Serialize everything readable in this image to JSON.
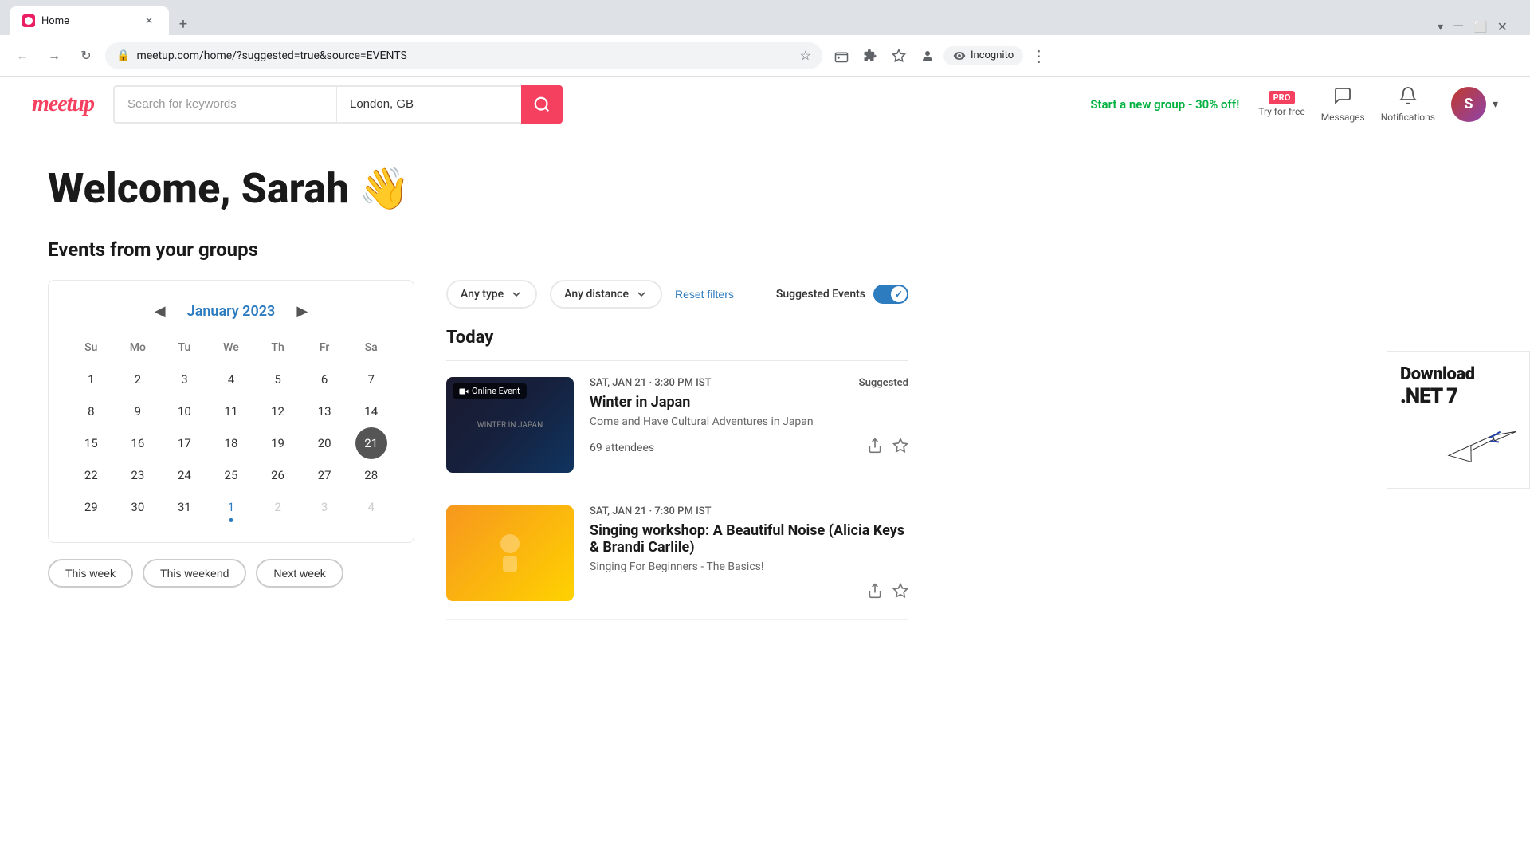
{
  "browser": {
    "tab": {
      "title": "Home",
      "favicon_label": "meetup-favicon"
    },
    "address": "meetup.com/home/?suggested=true&source=EVENTS",
    "incognito_label": "Incognito"
  },
  "header": {
    "logo": "meetup",
    "search_placeholder": "Search for keywords",
    "location_value": "London, GB",
    "search_button_label": "Search",
    "promo_text": "Start a new group - 30% off!",
    "pro_label": "PRO",
    "try_for_free_label": "Try for free",
    "messages_label": "Messages",
    "notifications_label": "Notifications",
    "dropdown_arrow": "▾"
  },
  "main": {
    "welcome_text": "Welcome, Sarah",
    "wave_emoji": "👋",
    "section_title": "Events from your groups"
  },
  "calendar": {
    "month_year": "January 2023",
    "prev_label": "◀",
    "next_label": "▶",
    "day_headers": [
      "Su",
      "Mo",
      "Tu",
      "We",
      "Th",
      "Fr",
      "Sa"
    ],
    "weeks": [
      [
        {
          "day": 1,
          "other": false
        },
        {
          "day": 2,
          "other": false
        },
        {
          "day": 3,
          "other": false
        },
        {
          "day": 4,
          "other": false
        },
        {
          "day": 5,
          "other": false
        },
        {
          "day": 6,
          "other": false
        },
        {
          "day": 7,
          "other": false
        }
      ],
      [
        {
          "day": 8,
          "other": false
        },
        {
          "day": 9,
          "other": false
        },
        {
          "day": 10,
          "other": false
        },
        {
          "day": 11,
          "other": false
        },
        {
          "day": 12,
          "other": false
        },
        {
          "day": 13,
          "other": false
        },
        {
          "day": 14,
          "other": false
        }
      ],
      [
        {
          "day": 15,
          "other": false
        },
        {
          "day": 16,
          "other": false
        },
        {
          "day": 17,
          "other": false
        },
        {
          "day": 18,
          "other": false
        },
        {
          "day": 19,
          "other": false
        },
        {
          "day": 20,
          "other": false
        },
        {
          "day": 21,
          "today": true
        }
      ],
      [
        {
          "day": 22,
          "other": false
        },
        {
          "day": 23,
          "other": false
        },
        {
          "day": 24,
          "other": false
        },
        {
          "day": 25,
          "other": false
        },
        {
          "day": 26,
          "other": false
        },
        {
          "day": 27,
          "other": false
        },
        {
          "day": 28,
          "other": false
        }
      ],
      [
        {
          "day": 29,
          "other": false
        },
        {
          "day": 30,
          "other": false
        },
        {
          "day": 31,
          "other": false
        },
        {
          "day": 1,
          "other": true,
          "dot": true
        },
        {
          "day": 2,
          "other": true
        },
        {
          "day": 3,
          "other": true
        },
        {
          "day": 4,
          "other": true
        }
      ]
    ],
    "quick_filters": [
      {
        "label": "This week",
        "key": "this-week"
      },
      {
        "label": "This weekend",
        "key": "this-weekend"
      },
      {
        "label": "Next week",
        "key": "next-week"
      }
    ]
  },
  "filters": {
    "type_label": "Any type",
    "distance_label": "Any distance",
    "reset_label": "Reset filters",
    "suggested_label": "Suggested Events",
    "toggle_active": true,
    "toggle_check": "✓"
  },
  "events": {
    "today_label": "Today",
    "items": [
      {
        "id": "winter-japan",
        "badge": "Online Event",
        "date": "SAT, JAN 21 · 3:30 PM IST",
        "suggested_badge": "Suggested",
        "title": "Winter in Japan",
        "description": "Come and Have Cultural Adventures in Japan",
        "attendees": "69 attendees",
        "thumbnail_type": "japan"
      },
      {
        "id": "singing-workshop",
        "badge": "",
        "date": "SAT, JAN 21 · 7:30 PM IST",
        "suggested_badge": "",
        "title": "Singing workshop: A Beautiful Noise (Alicia Keys & Brandi Carlile)",
        "description": "Singing For Beginners - The Basics!",
        "attendees": "",
        "thumbnail_type": "singing"
      }
    ]
  },
  "icons": {
    "back": "←",
    "forward": "→",
    "refresh": "↻",
    "lock": "🔒",
    "bookmark": "☆",
    "extensions": "⊞",
    "menu": "⋮",
    "search": "🔍",
    "messages": "💬",
    "bell": "🔔",
    "share": "↑",
    "star": "☆",
    "camera": "📷",
    "chevron_down": "▾"
  }
}
